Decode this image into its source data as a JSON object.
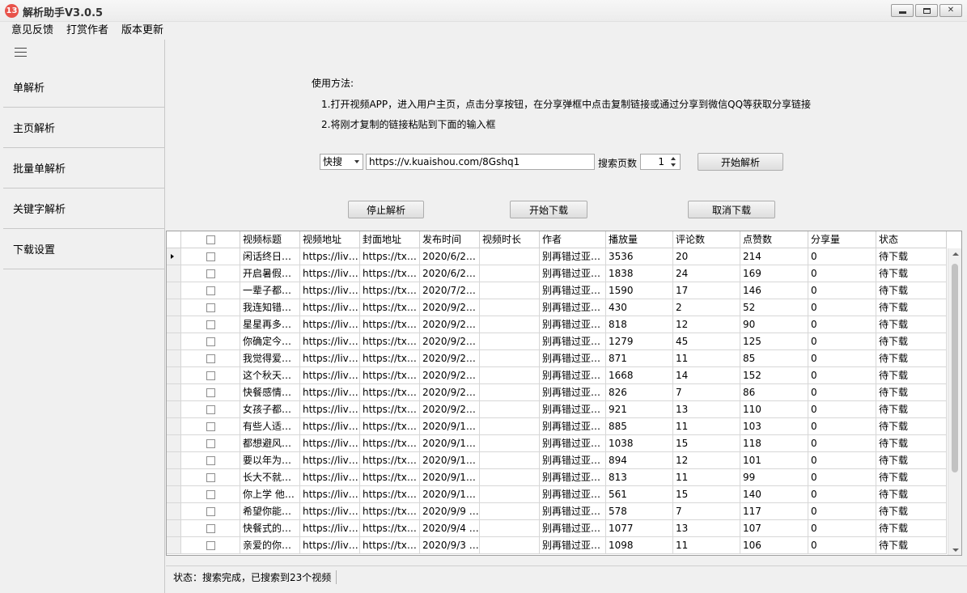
{
  "window": {
    "title": "解析助手V3.0.5",
    "logo_text": "13"
  },
  "menu": [
    "意见反馈",
    "打赏作者",
    "版本更新"
  ],
  "sidebar": {
    "items": [
      "单解析",
      "主页解析",
      "批量单解析",
      "关键字解析",
      "下载设置"
    ]
  },
  "usage": {
    "title": "使用方法:",
    "line1": "1.打开视频APP，进入用户主页，点击分享按钮，在分享弹框中点击复制链接或通过分享到微信QQ等获取分享链接",
    "line2": "2.将刚才复制的链接粘贴到下面的输入框"
  },
  "search": {
    "platform": "快搜",
    "url": "https://v.kuaishou.com/8Gshq1",
    "pages_label": "搜索页数",
    "pages_value": "1",
    "start_parse": "开始解析"
  },
  "actions": {
    "stop_parse": "停止解析",
    "start_download": "开始下载",
    "cancel_download": "取消下载"
  },
  "table": {
    "columns": [
      "视频标题",
      "视频地址",
      "封面地址",
      "发布时间",
      "视频时长",
      "作者",
      "播放量",
      "评论数",
      "点赞数",
      "分享量",
      "状态"
    ],
    "rows": [
      [
        "闲话终日…",
        "https://liv…",
        "https://tx…",
        "2020/6/2…",
        "",
        "别再错过亚…",
        "3536",
        "20",
        "214",
        "0",
        "待下载"
      ],
      [
        "开启暑假…",
        "https://liv…",
        "https://tx…",
        "2020/6/2…",
        "",
        "别再错过亚…",
        "1838",
        "24",
        "169",
        "0",
        "待下载"
      ],
      [
        "一辈子都…",
        "https://liv…",
        "https://tx…",
        "2020/7/2…",
        "",
        "别再错过亚…",
        "1590",
        "17",
        "146",
        "0",
        "待下载"
      ],
      [
        "我连知错…",
        "https://liv…",
        "https://tx…",
        "2020/9/2…",
        "",
        "别再错过亚…",
        "430",
        "2",
        "52",
        "0",
        "待下载"
      ],
      [
        "星星再多…",
        "https://liv…",
        "https://tx…",
        "2020/9/2…",
        "",
        "别再错过亚…",
        "818",
        "12",
        "90",
        "0",
        "待下载"
      ],
      [
        "你确定今…",
        "https://liv…",
        "https://tx…",
        "2020/9/2…",
        "",
        "别再错过亚…",
        "1279",
        "45",
        "125",
        "0",
        "待下载"
      ],
      [
        "我觉得爱…",
        "https://liv…",
        "https://tx…",
        "2020/9/2…",
        "",
        "别再错过亚…",
        "871",
        "11",
        "85",
        "0",
        "待下载"
      ],
      [
        "这个秋天…",
        "https://liv…",
        "https://tx…",
        "2020/9/2…",
        "",
        "别再错过亚…",
        "1668",
        "14",
        "152",
        "0",
        "待下载"
      ],
      [
        "快餐感情…",
        "https://liv…",
        "https://tx…",
        "2020/9/2…",
        "",
        "别再错过亚…",
        "826",
        "7",
        "86",
        "0",
        "待下载"
      ],
      [
        "女孩子都…",
        "https://liv…",
        "https://tx…",
        "2020/9/2…",
        "",
        "别再错过亚…",
        "921",
        "13",
        "110",
        "0",
        "待下载"
      ],
      [
        "有些人适…",
        "https://liv…",
        "https://tx…",
        "2020/9/1…",
        "",
        "别再错过亚…",
        "885",
        "11",
        "103",
        "0",
        "待下载"
      ],
      [
        "都想避风…",
        "https://liv…",
        "https://tx…",
        "2020/9/1…",
        "",
        "别再错过亚…",
        "1038",
        "15",
        "118",
        "0",
        "待下载"
      ],
      [
        "要以年为…",
        "https://liv…",
        "https://tx…",
        "2020/9/1…",
        "",
        "别再错过亚…",
        "894",
        "12",
        "101",
        "0",
        "待下载"
      ],
      [
        "长大不就…",
        "https://liv…",
        "https://tx…",
        "2020/9/1…",
        "",
        "别再错过亚…",
        "813",
        "11",
        "99",
        "0",
        "待下载"
      ],
      [
        "你上学 他…",
        "https://liv…",
        "https://tx…",
        "2020/9/1…",
        "",
        "别再错过亚…",
        "561",
        "15",
        "140",
        "0",
        "待下载"
      ],
      [
        "希望你能…",
        "https://liv…",
        "https://tx…",
        "2020/9/9 …",
        "",
        "别再错过亚…",
        "578",
        "7",
        "117",
        "0",
        "待下载"
      ],
      [
        "快餐式的…",
        "https://liv…",
        "https://tx…",
        "2020/9/4 …",
        "",
        "别再错过亚…",
        "1077",
        "13",
        "107",
        "0",
        "待下载"
      ],
      [
        "亲爱的你…",
        "https://liv…",
        "https://tx…",
        "2020/9/3 …",
        "",
        "别再错过亚…",
        "1098",
        "11",
        "106",
        "0",
        "待下载"
      ]
    ]
  },
  "status": {
    "text": "状态：搜索完成，已搜索到23个视频"
  },
  "colors": {
    "logo": "#e8524a",
    "window_bg": "#f0f0f0",
    "grid_bg": "#ffffff"
  }
}
